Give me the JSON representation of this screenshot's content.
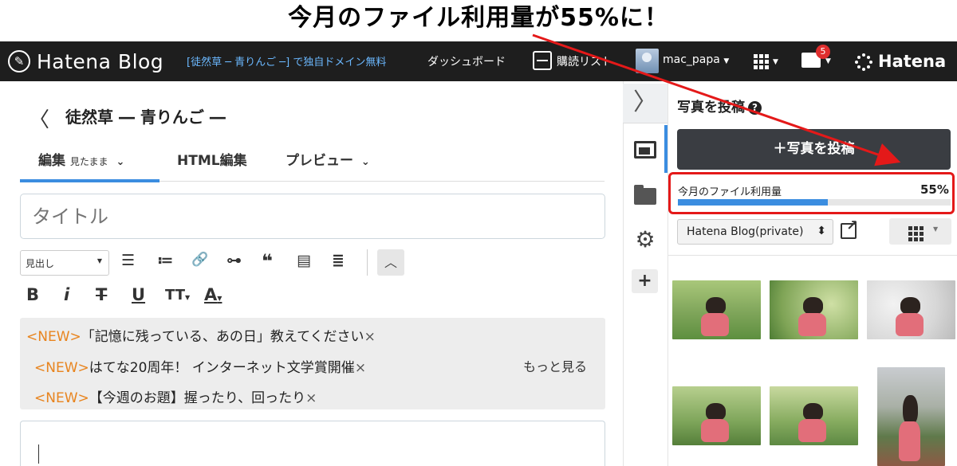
{
  "annotation": {
    "headline": "今月のファイル利用量が55%に！"
  },
  "topnav": {
    "brand": "Hatena Blog",
    "brand_logo": "✎",
    "promo": "[徒然草 ─ 青りんご ─] で独自ドメイン無料",
    "dashboard": "ダッシュボード",
    "subscriptions": "購読リスト",
    "username": "mac_papa",
    "notification_count": "5",
    "hatena": "Hatena"
  },
  "editor": {
    "back": "〈",
    "blog_title": "徒然草 ― 青りんご ―",
    "tabs": [
      {
        "label": "編集",
        "sub": "見たまま"
      },
      {
        "label": "HTML編集"
      },
      {
        "label": "プレビュー"
      }
    ],
    "title_placeholder": "タイトル",
    "heading_select": "見出し",
    "toolbar_row1": [
      "☰",
      "≔",
      "🔗",
      "⊶",
      "❝",
      "▤",
      "≣"
    ],
    "toolbar_row2": [
      "B",
      "i",
      "T",
      "U",
      "TT",
      "A"
    ],
    "collapse": "︿",
    "news": [
      {
        "tag": "<NEW>",
        "text": "「記憶に残っている、あの日」教えてください",
        "close": "×"
      },
      {
        "tag": "<NEW>",
        "text": "はてな20周年！ インターネット文学賞開催",
        "close": "×"
      },
      {
        "tag": "<NEW>",
        "text": "【今週のお題】握ったり、回ったり",
        "close": "×"
      }
    ],
    "more": "もっと見る"
  },
  "rail": {
    "toggle": "〉",
    "settings": "⚙",
    "add": "+"
  },
  "panel": {
    "title": "写真を投稿",
    "help": "?",
    "post_button": "＋写真を投稿",
    "usage_label": "今月のファイル利用量",
    "usage_percent_text": "55%",
    "usage_fraction": 0.55,
    "blog_select": "Hatena Blog(private)",
    "select_arrows": "⬍"
  },
  "colors": {
    "accent": "#3b8de0",
    "highlight": "#e41919",
    "nav_bg": "#1e1e1e",
    "news_tag": "#e8841e"
  }
}
